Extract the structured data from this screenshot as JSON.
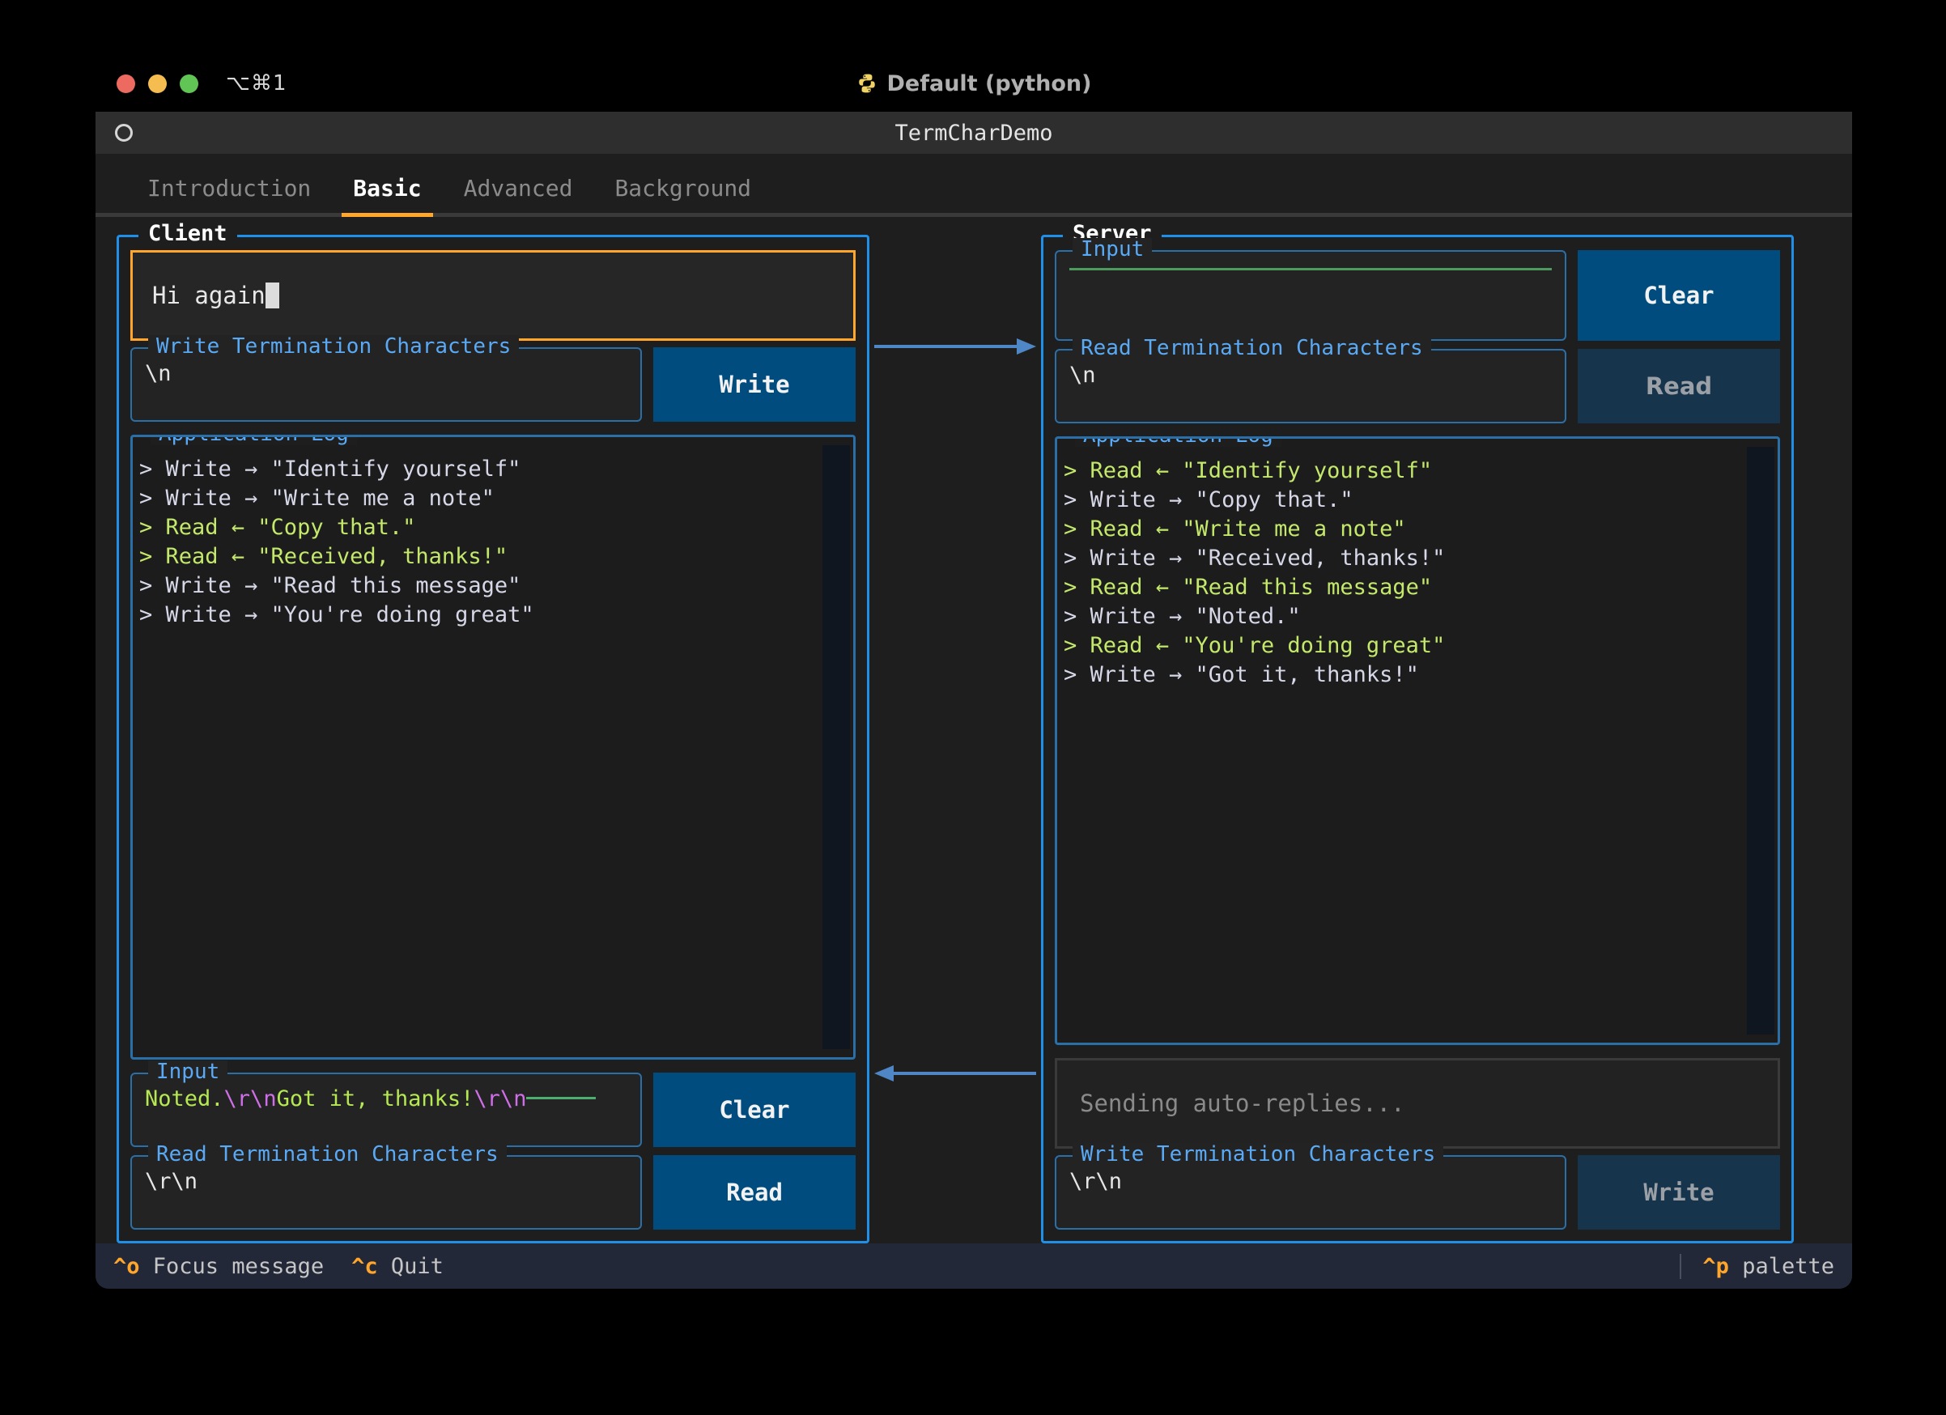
{
  "window": {
    "shortcut": "⌥⌘1",
    "session_title": "Default (python)",
    "python_icon": "python-logo-icon",
    "lights": [
      "close",
      "minimize",
      "zoom"
    ]
  },
  "app": {
    "icon": "circle-icon",
    "title": "TermCharDemo",
    "tabs": [
      {
        "label": "Introduction",
        "active": false
      },
      {
        "label": "Basic",
        "active": true
      },
      {
        "label": "Advanced",
        "active": false
      },
      {
        "label": "Background",
        "active": false
      }
    ]
  },
  "client": {
    "panel_title": "Client",
    "message_input": {
      "value": "Hi again",
      "cursor": true
    },
    "write_term": {
      "title": "Write Termination Characters",
      "value": "\\n"
    },
    "write_button": {
      "label": "Write",
      "disabled": false
    },
    "log": {
      "title": "Application Log",
      "lines": [
        {
          "kind": "write",
          "text": "> Write → \"Identify yourself\""
        },
        {
          "kind": "write",
          "text": "> Write → \"Write me a note\""
        },
        {
          "kind": "read",
          "text": "> Read ← \"Copy that.\""
        },
        {
          "kind": "read",
          "text": "> Read ← \"Received, thanks!\""
        },
        {
          "kind": "write",
          "text": "> Write → \"Read this message\""
        },
        {
          "kind": "write",
          "text": "> Write → \"You're doing great\""
        }
      ]
    },
    "input_buffer": {
      "title": "Input",
      "segments": [
        {
          "text": "Noted.",
          "color": "green"
        },
        {
          "text": "\\r\\n",
          "color": "magenta"
        },
        {
          "text": "Got it, thanks!",
          "color": "green"
        },
        {
          "text": "\\r\\n",
          "color": "magenta"
        }
      ],
      "trailing_rule": true
    },
    "clear_button": {
      "label": "Clear",
      "disabled": false
    },
    "read_term": {
      "title": "Read Termination Characters",
      "value": "\\r\\n"
    },
    "read_button": {
      "label": "Read",
      "disabled": false
    }
  },
  "server": {
    "panel_title": "Server",
    "input_buffer": {
      "title": "Input",
      "segments": [],
      "empty_rule": true
    },
    "clear_button": {
      "label": "Clear",
      "disabled": false
    },
    "read_term": {
      "title": "Read Termination Characters",
      "value": "\\n"
    },
    "read_button": {
      "label": "Read",
      "disabled": true
    },
    "log": {
      "title": "Application Log",
      "lines": [
        {
          "kind": "read",
          "text": "> Read ← \"Identify yourself\""
        },
        {
          "kind": "write",
          "text": "> Write → \"Copy that.\""
        },
        {
          "kind": "read",
          "text": "> Read ← \"Write me a note\""
        },
        {
          "kind": "write",
          "text": "> Write → \"Received, thanks!\""
        },
        {
          "kind": "read",
          "text": "> Read ← \"Read this message\""
        },
        {
          "kind": "write",
          "text": "> Write → \"Noted.\""
        },
        {
          "kind": "read",
          "text": "> Read ← \"You're doing great\""
        },
        {
          "kind": "write",
          "text": "> Write → \"Got it, thanks!\""
        }
      ]
    },
    "status": {
      "placeholder": "Sending auto-replies..."
    },
    "write_term": {
      "title": "Write Termination Characters",
      "value": "\\r\\n"
    },
    "write_button": {
      "label": "Write",
      "disabled": true
    }
  },
  "arrows": {
    "top": {
      "direction": "right",
      "name": "client-to-server-arrow"
    },
    "bottom": {
      "direction": "left",
      "name": "server-to-client-arrow"
    }
  },
  "footer": {
    "bindings": [
      {
        "key": "^o",
        "label": "Focus message"
      },
      {
        "key": "^c",
        "label": "Quit"
      }
    ],
    "right": {
      "key": "^p",
      "label": "palette"
    }
  },
  "colors": {
    "accent_orange": "#ffa62b",
    "panel_blue": "#1f8fe8",
    "field_blue": "#2a6fa8",
    "label_blue": "#5aa9f5",
    "button_blue": "#004c7e",
    "button_disabled": "#17344d",
    "log_read_green": "#c3e86b",
    "log_write": "#d6d8e8",
    "escape_magenta": "#cf6fe8",
    "buffer_green": "#b5e853"
  }
}
